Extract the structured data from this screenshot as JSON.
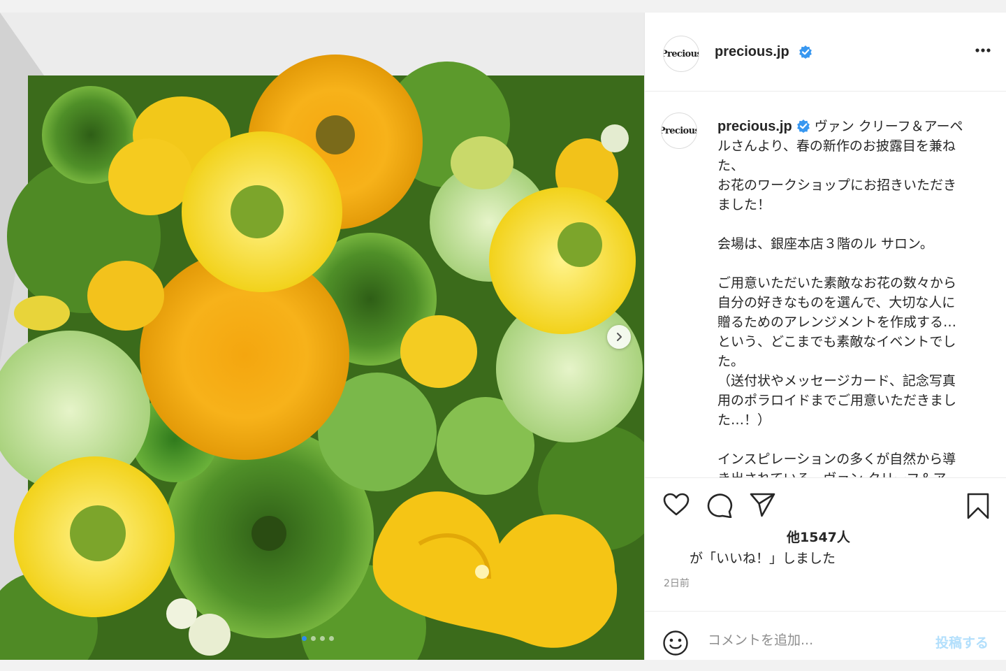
{
  "post": {
    "username": "precious.jp",
    "avatar_text": "Precious",
    "caption_lines": [
      "ルさんより、春の新作のお披露目を兼ね",
      "た、",
      "お花のワークショップにお招きいただき",
      "ました！",
      "",
      "会場は、銀座本店３階のル サロン。",
      "",
      "ご用意いただいた素敵なお花の数々から",
      "自分の好きなものを選んで、大切な人に",
      "贈るためのアレンジメントを作成する…",
      "という、どこまでも素敵なイベントでし",
      "た。",
      "（送付状やメッセージカード、記念写真",
      "用のポラロイドまでご用意いただきまし",
      "た…！）",
      "",
      "インスピレーションの多くが自然から導",
      "き出されている、ヴァン クリーフ＆ア"
    ],
    "caption_first": "ヴァン クリーフ＆アーペ",
    "likes_line1": "他1547人",
    "likes_line2": "が「いいね！」しました",
    "time_ago": "2日前"
  },
  "comment": {
    "placeholder": "コメントを追加...",
    "submit_label": "投稿する"
  },
  "icons": {
    "verified": "verified-badge-icon",
    "more": "more-options-icon",
    "like": "heart-icon",
    "comment": "comment-icon",
    "share": "send-icon",
    "save": "bookmark-icon",
    "emoji": "emoji-icon",
    "next": "chevron-right-icon"
  },
  "carousel": {
    "total": 4,
    "active_index": 0
  },
  "colors": {
    "verified": "#3897f0",
    "post_button_disabled": "#b2dffc",
    "active_dot": "#2e8bf0"
  }
}
